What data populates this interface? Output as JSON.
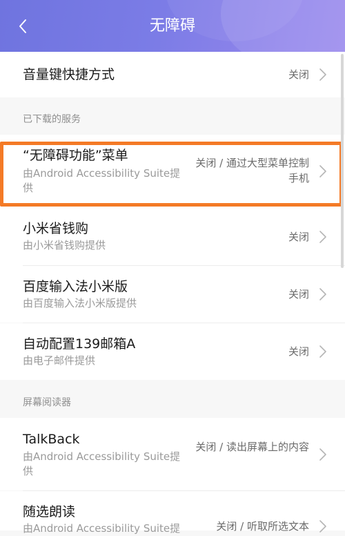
{
  "header": {
    "title": "无障碍"
  },
  "rows": {
    "volume_shortcut": {
      "title": "音量键快捷方式",
      "status": "关闭"
    },
    "menu": {
      "title": "“无障碍功能”菜单",
      "subtitle": "由Android Accessibility Suite提供",
      "status": "关闭 / 通过大型菜单控制手机"
    },
    "mishengqian": {
      "title": "小米省钱购",
      "subtitle": "由小米省钱购提供",
      "status": "关闭"
    },
    "baidu_ime": {
      "title": "百度输入法小米版",
      "subtitle": "由百度输入法小米版提供",
      "status": "关闭"
    },
    "mail139": {
      "title": "自动配置139邮箱A",
      "subtitle": "由电子邮件提供",
      "status": "关闭"
    },
    "talkback": {
      "title": "TalkBack",
      "subtitle": "由Android Accessibility Suite提供",
      "status": "关闭 / 读出屏幕上的内容"
    },
    "select_to_speak": {
      "title": "随选朗读",
      "subtitle": "由Android Accessibility Suite提",
      "status": "关闭 / 听取所选文本"
    }
  },
  "sections": {
    "downloaded": "已下载的服务",
    "screen_reader": "屏幕阅读器"
  },
  "colors": {
    "header_gradient_start": "#6f74df",
    "header_gradient_end": "#9b8bee",
    "highlight_border": "#f47a26"
  }
}
